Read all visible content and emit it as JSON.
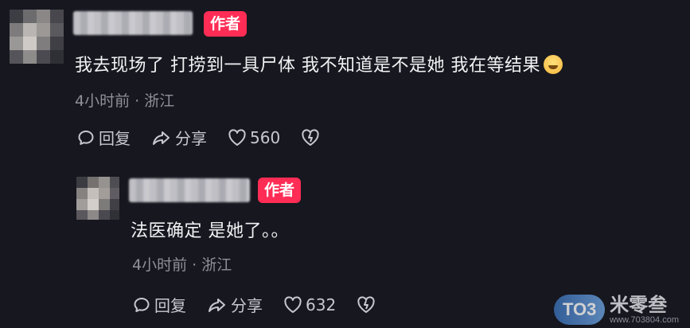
{
  "comments": [
    {
      "badge": "作者",
      "text": "我去现场了 打捞到一具尸体 我不知道是不是她 我在等结果",
      "emoji": "anxious-face-emoji",
      "time": "4小时前",
      "location": "浙江",
      "reply_label": "回复",
      "share_label": "分享",
      "likes": "560"
    },
    {
      "badge": "作者",
      "text": "法医确定 是她了。。",
      "time": "4小时前",
      "location": "浙江",
      "reply_label": "回复",
      "share_label": "分享",
      "likes": "632"
    }
  ],
  "meta_separator": "·",
  "watermark": {
    "logo": "TO3",
    "name": "米零叁",
    "url": "www.703804.com"
  },
  "colors": {
    "background": "#16171f",
    "badge": "#ff2d55",
    "meta": "#8f909a"
  }
}
